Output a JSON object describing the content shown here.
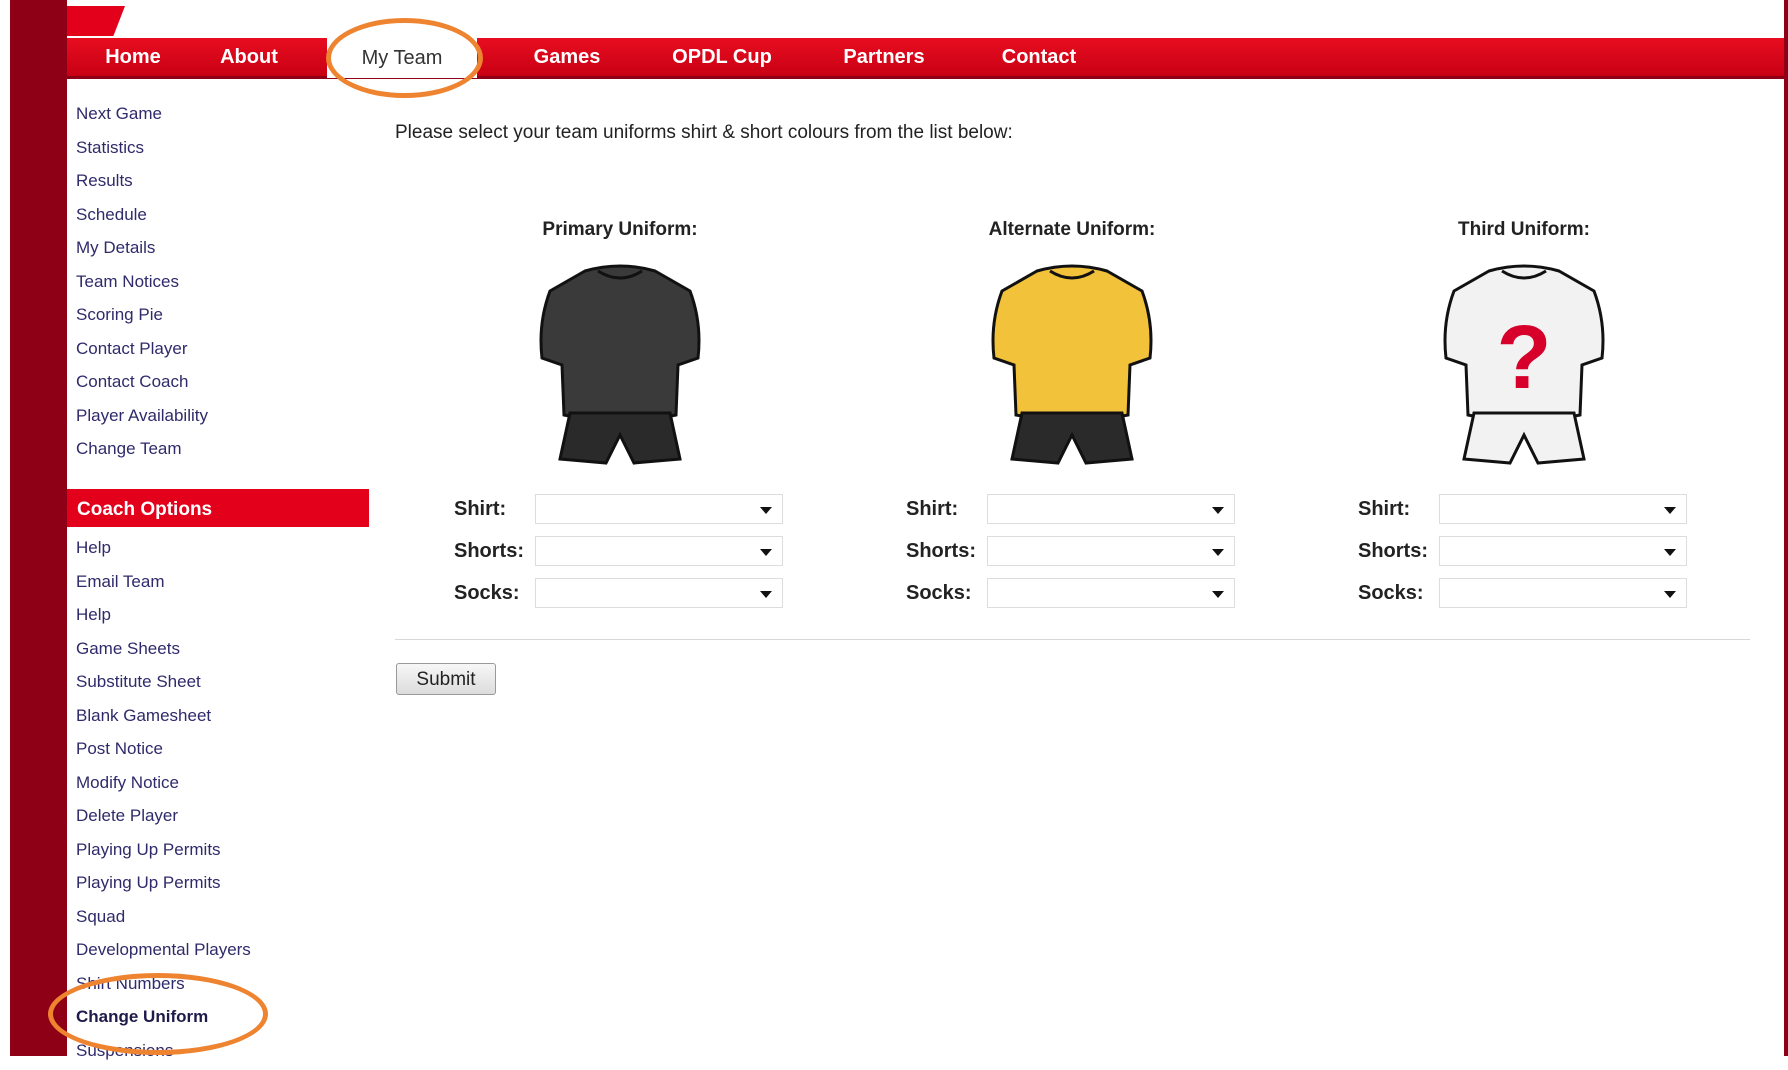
{
  "nav": {
    "items": [
      {
        "label": "Home"
      },
      {
        "label": "About"
      },
      {
        "label": "My Team"
      },
      {
        "label": "Games"
      },
      {
        "label": "OPDL Cup"
      },
      {
        "label": "Partners"
      },
      {
        "label": "Contact"
      }
    ],
    "active": "My Team"
  },
  "sidebar": {
    "team_items": [
      {
        "label": "Next Game"
      },
      {
        "label": "Statistics"
      },
      {
        "label": "Results"
      },
      {
        "label": "Schedule"
      },
      {
        "label": "My Details"
      },
      {
        "label": "Team Notices"
      },
      {
        "label": "Scoring Pie"
      },
      {
        "label": "Contact Player"
      },
      {
        "label": "Contact Coach"
      },
      {
        "label": "Player Availability"
      },
      {
        "label": "Change Team"
      }
    ],
    "coach_header": "Coach Options",
    "coach_items": [
      {
        "label": "Help"
      },
      {
        "label": "Email Team"
      },
      {
        "label": "Help"
      },
      {
        "label": "Game Sheets"
      },
      {
        "label": "Substitute Sheet"
      },
      {
        "label": "Blank Gamesheet"
      },
      {
        "label": "Post Notice"
      },
      {
        "label": "Modify Notice"
      },
      {
        "label": "Delete Player"
      },
      {
        "label": "Playing Up Permits"
      },
      {
        "label": "Playing Up Permits"
      },
      {
        "label": "Squad"
      },
      {
        "label": "Developmental Players"
      },
      {
        "label": "Shirt Numbers"
      },
      {
        "label": "Change Uniform"
      },
      {
        "label": "Suspensions"
      }
    ],
    "active_coach_item": "Change Uniform"
  },
  "main": {
    "intro": "Please select your team uniforms shirt & short colours from the list below:",
    "uniforms": [
      {
        "title": "Primary Uniform:",
        "shirt_color": "#3a3a3a",
        "shorts_color": "#2a2a2a",
        "icon": "black-kit-icon"
      },
      {
        "title": "Alternate Uniform:",
        "shirt_color": "#f2c23a",
        "shorts_color": "#2a2a2a",
        "icon": "yellow-kit-icon"
      },
      {
        "title": "Third Uniform:",
        "shirt_color": "#f2f2f2",
        "shorts_color": "#f2f2f2",
        "icon": "unknown-kit-icon",
        "mark": "?"
      }
    ],
    "fields": {
      "shirt": "Shirt:",
      "shorts": "Shorts:",
      "socks": "Socks:"
    },
    "submit_label": "Submit"
  },
  "colors": {
    "nav_red": "#e3001b",
    "maroon": "#8d0016",
    "highlight_orange": "#ee8330",
    "link_color": "#2f2a6a"
  }
}
